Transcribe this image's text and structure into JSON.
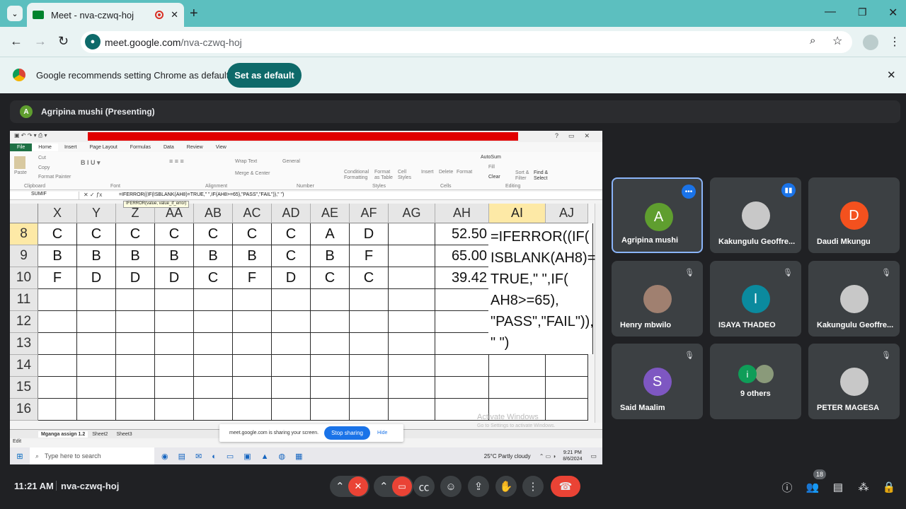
{
  "browser": {
    "tab_title": "Meet - nva-czwq-hoj",
    "url_prefix": "meet.google.com",
    "url_path": "/nva-czwq-hoj",
    "infobar_text": "Google recommends setting Chrome as default",
    "infobar_button": "Set as default",
    "accent": "#5cbfbf"
  },
  "meet": {
    "presenter_initial": "A",
    "presenter_label": "Agripina mushi (Presenting)",
    "time": "11:21 AM",
    "meeting_code": "nva-czwq-hoj",
    "participant_count": "18",
    "participants": [
      {
        "name": "Agripina mushi",
        "initial": "A",
        "color": "#5f9e2f"
      },
      {
        "name": "Kakungulu Geoffre...",
        "initial": "",
        "color": "#c8c8c8"
      },
      {
        "name": "Daudi Mkungu",
        "initial": "D",
        "color": "#f4511e"
      },
      {
        "name": "Henry mbwilo",
        "initial": "",
        "color": "#a08070"
      },
      {
        "name": "ISAYA THADEO",
        "initial": "I",
        "color": "#0b8a9e"
      },
      {
        "name": "Kakungulu Geoffre...",
        "initial": "",
        "color": "#c8c8c8"
      },
      {
        "name": "Said Maalim",
        "initial": "S",
        "color": "#7e57c2"
      },
      {
        "name": "9 others",
        "initial": "i",
        "color": "#0f9d58"
      },
      {
        "name": "PETER MAGESA",
        "initial": "",
        "color": "#c8c8c8"
      }
    ]
  },
  "excel": {
    "tabs": [
      "File",
      "Home",
      "Insert",
      "Page Layout",
      "Formulas",
      "Data",
      "Review",
      "View"
    ],
    "namebox": "SUMIF",
    "formula": "=IFERROR((IF(ISBLANK(AH8)=TRUE,\" \",IF(AH8>=65),\"PASS\",\"FAIL\")),\" \")",
    "tooltip": "IFERROR(value, value_if_error)",
    "ribbon_groups": [
      "Clipboard",
      "Font",
      "Alignment",
      "Number",
      "Styles",
      "Cells",
      "Editing"
    ],
    "ribbon_items": {
      "paste": "Paste",
      "cut": "Cut",
      "copy": "Copy",
      "painter": "Format Painter",
      "wrap": "Wrap Text",
      "merge": "Merge & Center",
      "general": "General",
      "cond": "Conditional Formatting",
      "fmt_table": "Format as Table",
      "cell_styles": "Cell Styles",
      "insert": "Insert",
      "delete": "Delete",
      "format": "Format",
      "autosum": "AutoSum",
      "fill": "Fill",
      "clear": "Clear",
      "sort": "Sort & Filter",
      "find": "Find & Select"
    },
    "columns": [
      "X",
      "Y",
      "Z",
      "AA",
      "AB",
      "AC",
      "AD",
      "AE",
      "AF",
      "AG",
      "AH",
      "AI",
      "AJ"
    ],
    "rows": [
      "8",
      "9",
      "10",
      "11",
      "12",
      "13",
      "14",
      "15",
      "16"
    ],
    "data": [
      [
        "C",
        "C",
        "C",
        "C",
        "C",
        "C",
        "C",
        "A",
        "D",
        "",
        "52.50"
      ],
      [
        "B",
        "B",
        "B",
        "B",
        "B",
        "B",
        "C",
        "B",
        "F",
        "",
        "65.00"
      ],
      [
        "F",
        "D",
        "D",
        "D",
        "C",
        "F",
        "D",
        "C",
        "C",
        "",
        "39.42"
      ]
    ],
    "formula_cell_lines": [
      "=IFERROR((IF(",
      "ISBLANK(AH8)=",
      "TRUE,\" \",IF(",
      "AH8>=65),",
      "\"PASS\",\"FAIL\")),",
      "\" \")"
    ],
    "sheets": [
      "Mganga assign 1.2",
      "Sheet2",
      "Sheet3"
    ],
    "status": "Edit",
    "sharing_text": "meet.google.com is sharing your screen.",
    "stop_sharing": "Stop sharing",
    "hide": "Hide",
    "watermark_1": "Activate Windows",
    "watermark_2": "Go to Settings to activate Windows."
  },
  "taskbar": {
    "search_placeholder": "Type here to search",
    "weather": "25°C  Partly cloudy",
    "clock_time": "9:21 PM",
    "clock_date": "8/6/2024"
  }
}
